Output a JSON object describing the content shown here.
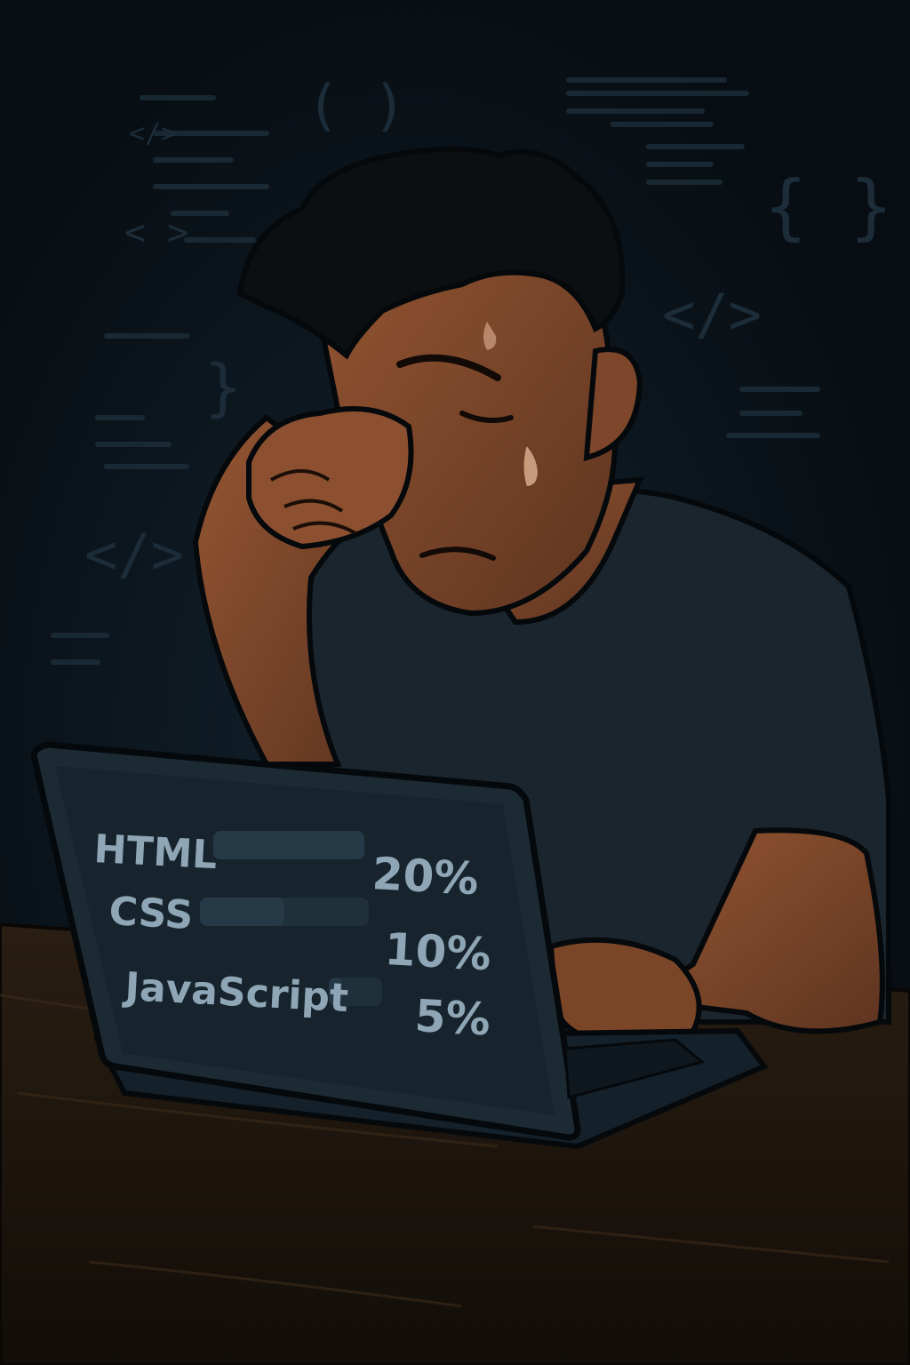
{
  "illustration": {
    "subject": "programmer wiping tears at laptop",
    "colors": {
      "background": "#0b151e",
      "skin": "#8a4e2c",
      "shirt": "#1a252d",
      "desk": "#22190f",
      "laptop": "#1c2a34",
      "screen_text": "#8ea6b5",
      "bar": "#263946"
    }
  },
  "laptop_screen": {
    "skills": [
      {
        "label": "HTML",
        "percent_text": "20%",
        "value": 20
      },
      {
        "label": "CSS",
        "percent_text": "10%",
        "value": 10
      },
      {
        "label": "JavaScript",
        "percent_text": "5%",
        "value": 5
      }
    ]
  },
  "background_glyphs": [
    "( )",
    "{ }",
    "</>",
    "< >",
    "}",
    "</>",
    "{ }",
    "</>"
  ]
}
